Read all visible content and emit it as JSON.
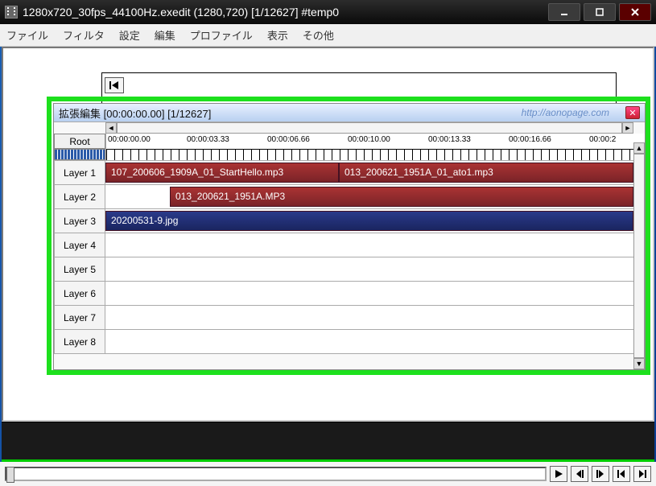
{
  "window": {
    "title": "1280x720_30fps_44100Hz.exedit (1280,720)  [1/12627]  #temp0"
  },
  "menu": {
    "file": "ファイル",
    "filter": "フィルタ",
    "settings": "設定",
    "edit": "編集",
    "profile": "プロファイル",
    "view": "表示",
    "other": "その他"
  },
  "timeline": {
    "title": "拡張編集 [00:00:00.00] [1/12627]",
    "watermark": "http://aonopage.com",
    "root": "Root",
    "ruler": {
      "t0": "00:00:00.00",
      "t1": "00:00:03.33",
      "t2": "00:00:06.66",
      "t3": "00:00:10.00",
      "t4": "00:00:13.33",
      "t5": "00:00:16.66",
      "t6": "00:00:2"
    },
    "layers": {
      "l1": "Layer 1",
      "l2": "Layer 2",
      "l3": "Layer 3",
      "l4": "Layer 4",
      "l5": "Layer 5",
      "l6": "Layer 6",
      "l7": "Layer 7",
      "l8": "Layer 8"
    },
    "clips": {
      "c1": "107_200606_1909A_01_StartHello.mp3",
      "c2": "013_200621_1951A_01_ato1.mp3",
      "c3": "013_200621_1951A.MP3",
      "c4": "20200531-9.jpg"
    }
  }
}
